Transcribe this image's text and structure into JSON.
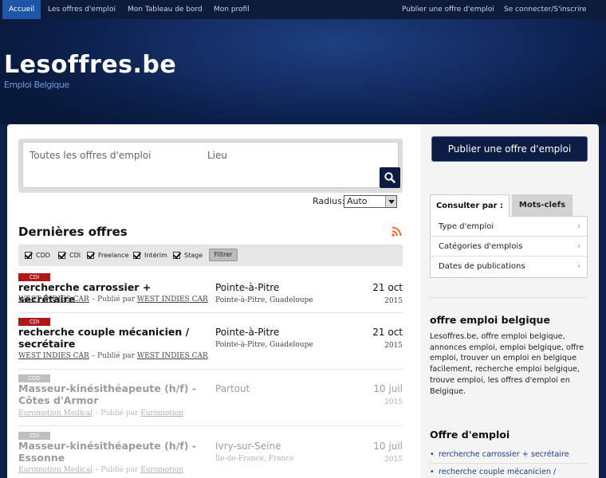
{
  "nav": {
    "left": [
      "Accueil",
      "Les offres d'emploi",
      "Mon Tableau de bord",
      "Mon profil"
    ],
    "right": [
      "Publier une offre d'emploi",
      "Se connecter/S'inscrire"
    ]
  },
  "header": {
    "title": "Lesoffres.be",
    "subtitle": "Emploi Belgique"
  },
  "search": {
    "keywords_placeholder": "Toutes les offres d'emploi",
    "location_placeholder": "Lieu",
    "radius_label": "Radius:",
    "radius_value": "Auto"
  },
  "latest": {
    "title": "Dernières offres",
    "filters": [
      "CDD",
      "CDI",
      "Freelance",
      "Intérim",
      "Stage"
    ],
    "filter_button": "Filtrer"
  },
  "offers": [
    {
      "type": "CDI",
      "badge_color": "#b01717",
      "title": "rercherche carrossier + secrétaire",
      "company": "WEST INDIES CAR",
      "published_by_label": "– Publié par",
      "publisher": "WEST INDIES CAR",
      "location": "Pointe-à-Pitre",
      "region": "Pointe-à-Pitre, Guadeloupe",
      "day": "21 oct",
      "year": "2015"
    },
    {
      "type": "CDI",
      "badge_color": "#b01717",
      "title": "recherche couple mécanicien / secrétaire",
      "company": "WEST INDIES CAR",
      "published_by_label": "– Publié par",
      "publisher": "WEST INDIES CAR",
      "location": "Pointe-à-Pitre",
      "region": "Pointe-à-Pitre, Guadeloupe",
      "day": "21 oct",
      "year": "2015"
    },
    {
      "type": "CDD",
      "badge_color": "#666666",
      "title": "Masseur-kinésithéapeute (h/f) - Côtes d'Armor",
      "company": "Euromotion Medical",
      "published_by_label": "– Publié par",
      "publisher": "Euromotion",
      "location": "Partout",
      "region": "",
      "day": "10 juil",
      "year": "2015"
    },
    {
      "type": "CDI",
      "badge_color": "#666666",
      "title": "Masseur-kinésithéapeute (h/f) - Essonne",
      "company": "Euromotion Medical",
      "published_by_label": "– Publié par",
      "publisher": "Euromotion",
      "location": "Ivry-sur-Seine",
      "region": "Île-de-France, France",
      "day": "10 juil",
      "year": "2015"
    }
  ],
  "sidebar": {
    "publish_button": "Publier une offre d'emploi",
    "tabs": [
      "Consulter par :",
      "Mots-clefs"
    ],
    "browse": [
      "Type d'emploi",
      "Catégories d'emplois",
      "Dates de publications"
    ],
    "about_title": "offre emploi belgique",
    "about_text": "Lesoffres.be, offre emploi belgique, annonces emploi, emploi belgique, offre emploi, trouver un emploi en belgique facilement, recherche emploi belgique, trouve emploi, les offres d'emploi en Belgique.",
    "offre_title": "Offre d'emploi",
    "links": [
      "rercherche carrossier + secrétaire",
      "recherche couple mécanicien /"
    ]
  },
  "colors": {
    "nav_bg": "#0e1b3a",
    "nav_active": "#1e57a8",
    "brand_dark": "#0c1c45",
    "badge_red": "#b01717",
    "rss": "#f26522"
  }
}
